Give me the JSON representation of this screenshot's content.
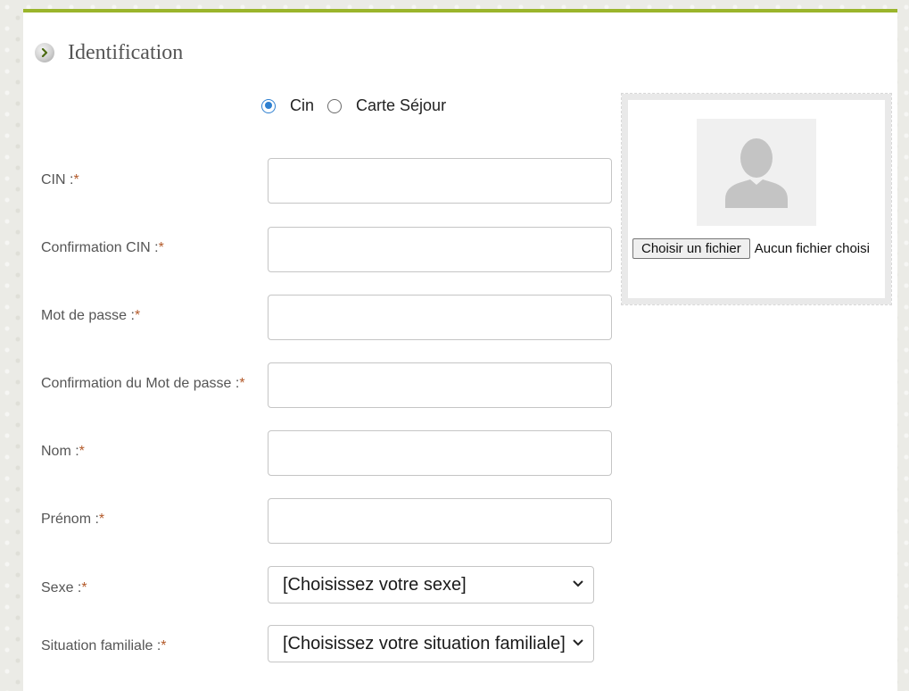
{
  "section": {
    "title": "Identification"
  },
  "id_type": {
    "options": [
      {
        "label": "Cin",
        "selected": true
      },
      {
        "label": "Carte Séjour",
        "selected": false
      }
    ]
  },
  "fields": {
    "cin": {
      "label": "CIN :",
      "value": ""
    },
    "cin_confirm": {
      "label": "Confirmation CIN :",
      "value": ""
    },
    "password": {
      "label": "Mot de passe :",
      "value": ""
    },
    "password_confirm": {
      "label": "Confirmation du Mot de passe :",
      "value": ""
    },
    "nom": {
      "label": "Nom :",
      "value": ""
    },
    "prenom": {
      "label": "Prénom :",
      "value": ""
    },
    "sexe": {
      "label": "Sexe :",
      "selected": "[Choisissez votre sexe]"
    },
    "situation": {
      "label": "Situation familiale :",
      "selected": "[Choisissez votre situation familiale]"
    }
  },
  "required_mark": "*",
  "photo": {
    "button_label": "Choisir un fichier",
    "status": "Aucun fichier choisi"
  },
  "colors": {
    "accent": "#9ab52b",
    "radio_selected": "#2f80d0",
    "required": "#b35a2a"
  }
}
